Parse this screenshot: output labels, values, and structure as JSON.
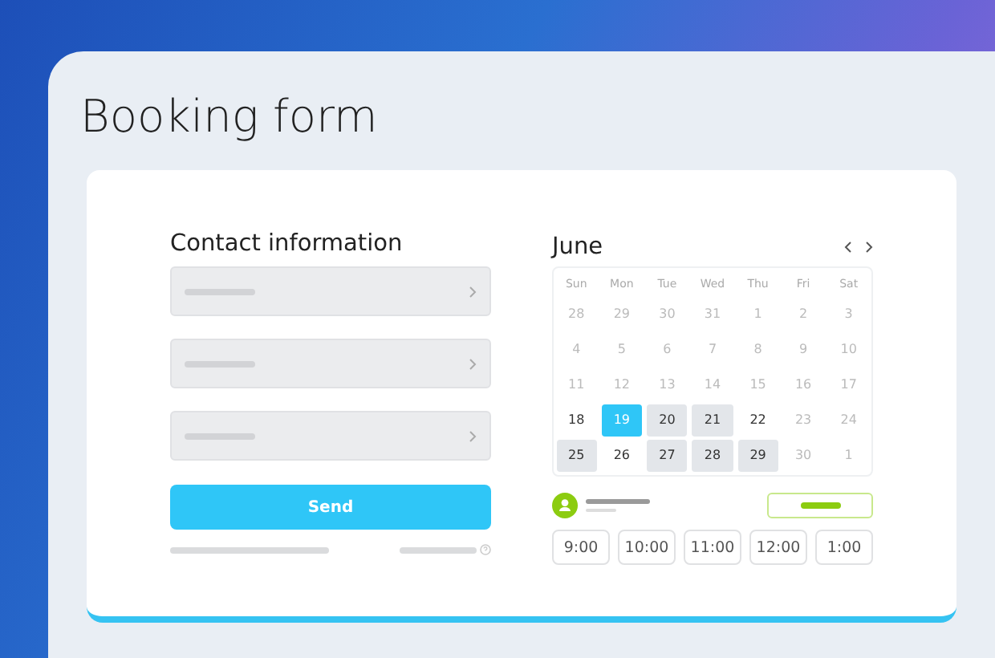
{
  "title": "Booking form",
  "contact": {
    "heading": "Contact information",
    "fields": [
      {
        "kind": "field"
      },
      {
        "kind": "field"
      },
      {
        "kind": "field"
      }
    ],
    "button": "Send"
  },
  "calendar": {
    "month": "June",
    "weekdays": [
      "Sun",
      "Mon",
      "Tue",
      "Wed",
      "Thu",
      "Fri",
      "Sat"
    ],
    "days": [
      {
        "label": "28",
        "kind": "muted",
        "selected": false
      },
      {
        "label": "29",
        "kind": "muted",
        "selected": false
      },
      {
        "label": "30",
        "kind": "muted",
        "selected": false
      },
      {
        "label": "31",
        "kind": "muted",
        "selected": false
      },
      {
        "label": "1",
        "kind": "muted",
        "selected": false
      },
      {
        "label": "2",
        "kind": "muted",
        "selected": false
      },
      {
        "label": "3",
        "kind": "muted",
        "selected": false
      },
      {
        "label": "4",
        "kind": "muted",
        "selected": false
      },
      {
        "label": "5",
        "kind": "muted",
        "selected": false
      },
      {
        "label": "6",
        "kind": "muted",
        "selected": false
      },
      {
        "label": "7",
        "kind": "muted",
        "selected": false
      },
      {
        "label": "8",
        "kind": "muted",
        "selected": false
      },
      {
        "label": "9",
        "kind": "muted",
        "selected": false
      },
      {
        "label": "10",
        "kind": "muted",
        "selected": false
      },
      {
        "label": "11",
        "kind": "muted",
        "selected": false
      },
      {
        "label": "12",
        "kind": "muted",
        "selected": false
      },
      {
        "label": "13",
        "kind": "muted",
        "selected": false
      },
      {
        "label": "14",
        "kind": "muted",
        "selected": false
      },
      {
        "label": "15",
        "kind": "muted",
        "selected": false
      },
      {
        "label": "16",
        "kind": "muted",
        "selected": false
      },
      {
        "label": "17",
        "kind": "muted",
        "selected": false
      },
      {
        "label": "18",
        "kind": "plain",
        "selected": false
      },
      {
        "label": "19",
        "kind": "available",
        "selected": true
      },
      {
        "label": "20",
        "kind": "available",
        "selected": false
      },
      {
        "label": "21",
        "kind": "available",
        "selected": false
      },
      {
        "label": "22",
        "kind": "plain",
        "selected": false
      },
      {
        "label": "23",
        "kind": "muted",
        "selected": false
      },
      {
        "label": "24",
        "kind": "muted",
        "selected": false
      },
      {
        "label": "25",
        "kind": "available",
        "selected": false
      },
      {
        "label": "26",
        "kind": "plain",
        "selected": false
      },
      {
        "label": "27",
        "kind": "available",
        "selected": false
      },
      {
        "label": "28",
        "kind": "available",
        "selected": false
      },
      {
        "label": "29",
        "kind": "available",
        "selected": false
      },
      {
        "label": "30",
        "kind": "muted",
        "selected": false
      },
      {
        "label": "1",
        "kind": "muted",
        "selected": false
      }
    ]
  },
  "times": [
    {
      "label": "9:00",
      "selected": false
    },
    {
      "label": "10:00",
      "selected": false
    },
    {
      "label": "11:00",
      "selected": false
    },
    {
      "label": "12:00",
      "selected": false
    },
    {
      "label": "1:00",
      "selected": false
    }
  ]
}
